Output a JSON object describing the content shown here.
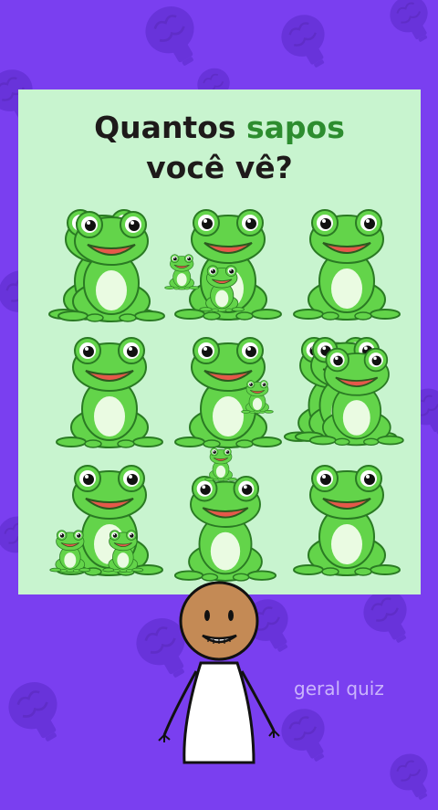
{
  "question": {
    "line1_prefix": "Quantos ",
    "line1_highlight": "sapos",
    "line2": "você vê?"
  },
  "watermark": "geral quiz",
  "colors": {
    "background": "#7a3ff0",
    "card": "#c8f4cf",
    "frog": "#63d44a",
    "highlight": "#2d8d2f"
  },
  "grid": {
    "cells": [
      {
        "variant": "double-behind"
      },
      {
        "variant": "with-two-small"
      },
      {
        "variant": "single"
      },
      {
        "variant": "single"
      },
      {
        "variant": "small-peek-right"
      },
      {
        "variant": "triple-stack"
      },
      {
        "variant": "two-small-front"
      },
      {
        "variant": "small-on-head"
      },
      {
        "variant": "single"
      }
    ]
  },
  "character": {
    "icon": "stick-figure-bald-smiling"
  },
  "background_icons": "brain-lightbulb-icon"
}
